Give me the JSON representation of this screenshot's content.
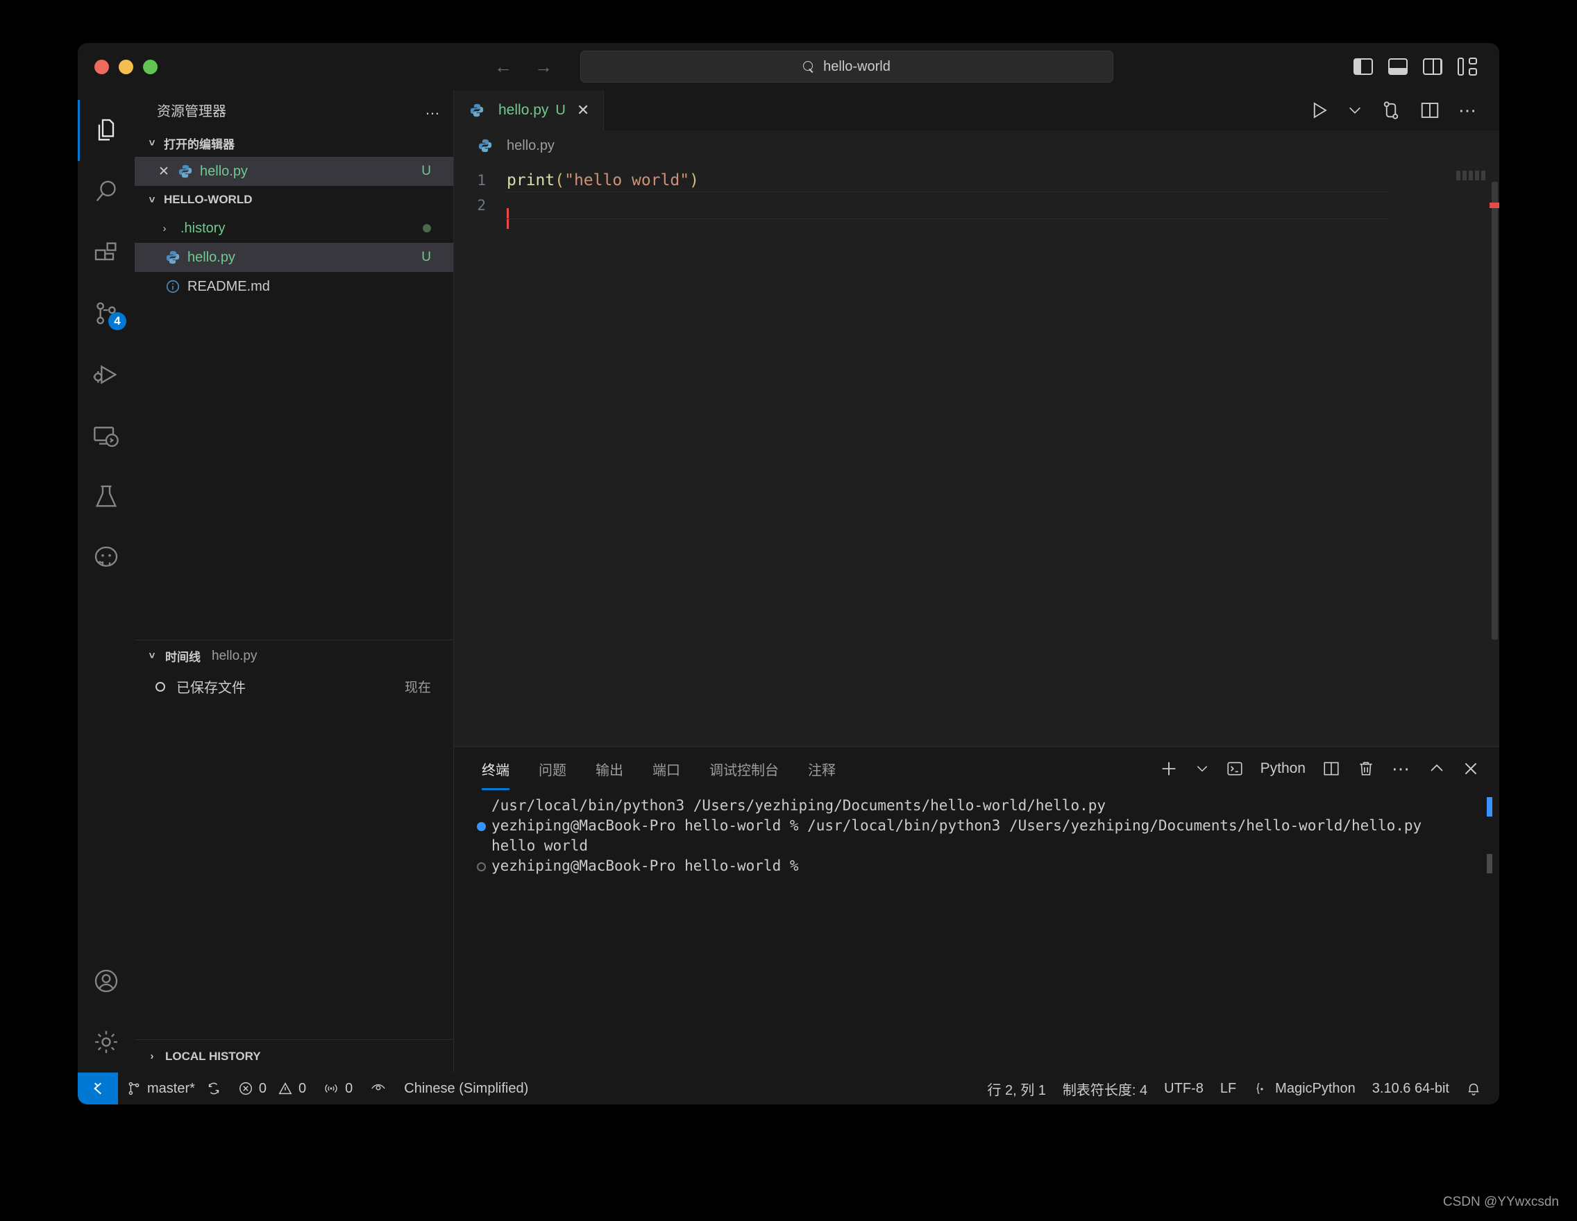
{
  "titlebar": {
    "search_value": "hello-world",
    "back_icon": "arrow-left-icon",
    "forward_icon": "arrow-right-icon",
    "layout_icons": [
      "toggle-primary-sidebar-icon",
      "toggle-panel-icon",
      "toggle-secondary-sidebar-icon",
      "customize-layout-icon"
    ]
  },
  "activitybar": {
    "items": [
      {
        "name": "explorer",
        "icon": "files-icon",
        "active": true,
        "badge": ""
      },
      {
        "name": "search",
        "icon": "search-icon",
        "active": false,
        "badge": ""
      },
      {
        "name": "extensions",
        "icon": "extensions-icon",
        "active": false,
        "badge": ""
      },
      {
        "name": "source-control",
        "icon": "source-control-icon",
        "active": false,
        "badge": "4"
      },
      {
        "name": "run-and-debug",
        "icon": "run-debug-icon",
        "active": false,
        "badge": ""
      },
      {
        "name": "remote-explorer",
        "icon": "remote-icon",
        "active": false,
        "badge": ""
      },
      {
        "name": "testing",
        "icon": "beaker-icon",
        "active": false,
        "badge": ""
      },
      {
        "name": "github",
        "icon": "github-icon",
        "active": false,
        "badge": ""
      }
    ],
    "bottom_items": [
      {
        "name": "accounts",
        "icon": "account-icon"
      },
      {
        "name": "settings",
        "icon": "gear-icon"
      }
    ]
  },
  "sidebar": {
    "title": "资源管理器",
    "more_label": "…",
    "open_editors": {
      "label": "打开的编辑器",
      "items": [
        {
          "name": "hello.py",
          "badge": "U",
          "close": "✕",
          "selected": true
        }
      ]
    },
    "workspace": {
      "label": "HELLO-WORLD",
      "items": [
        {
          "name": ".history",
          "kind": "folder",
          "badge": "",
          "dot": true,
          "selected": false
        },
        {
          "name": "hello.py",
          "kind": "python",
          "badge": "U",
          "dot": false,
          "selected": true
        },
        {
          "name": "README.md",
          "kind": "info",
          "badge": "",
          "dot": false,
          "selected": false
        }
      ]
    },
    "timeline": {
      "label": "时间线",
      "subject": "hello.py",
      "items": [
        {
          "label": "已保存文件",
          "when": "现在"
        }
      ]
    },
    "local_history": {
      "label": "LOCAL HISTORY"
    }
  },
  "editor": {
    "tabs": [
      {
        "label": "hello.py",
        "badge": "U",
        "close": "✕",
        "active": true
      }
    ],
    "toolbar_icons": [
      "run-python-file-icon",
      "run-chevron-icon",
      "source-control-compare-icon",
      "split-editor-icon",
      "more-actions-icon"
    ],
    "breadcrumb": "hello.py",
    "lines": [
      {
        "number": "1",
        "tokens": [
          {
            "text": "print",
            "type": "fn"
          },
          {
            "text": "(",
            "type": "paren"
          },
          {
            "text": "\"hello world\"",
            "type": "str"
          },
          {
            "text": ")",
            "type": "paren"
          }
        ]
      },
      {
        "number": "2",
        "tokens": []
      }
    ]
  },
  "panel": {
    "tabs": [
      {
        "label": "终端",
        "active": true
      },
      {
        "label": "问题",
        "active": false
      },
      {
        "label": "输出",
        "active": false
      },
      {
        "label": "端口",
        "active": false
      },
      {
        "label": "调试控制台",
        "active": false
      },
      {
        "label": "注释",
        "active": false
      }
    ],
    "terminal_name": "Python",
    "action_icons": [
      "new-terminal-icon",
      "terminal-profile-chevron-icon",
      "terminal-icon",
      "split-terminal-icon",
      "kill-terminal-icon",
      "more-actions-icon",
      "maximize-panel-icon",
      "close-panel-icon"
    ],
    "terminal_lines": [
      {
        "marker": "none",
        "text": "/usr/local/bin/python3 /Users/yezhiping/Documents/hello-world/hello.py"
      },
      {
        "marker": "filled",
        "text": "yezhiping@MacBook-Pro hello-world % /usr/local/bin/python3 /Users/yezhiping/Documents/hello-world/hello.py"
      },
      {
        "marker": "none",
        "text": "hello world"
      },
      {
        "marker": "empty",
        "text": "yezhiping@MacBook-Pro hello-world % "
      }
    ]
  },
  "statusbar": {
    "remote_icon": "remote-window-icon",
    "branch": "master*",
    "sync_icon": "sync-icon",
    "errors": "0",
    "warnings": "0",
    "ports": "0",
    "eye_icon": "eye-icon",
    "language_mode_left": "Chinese (Simplified)",
    "cursor_position": "行 2, 列 1",
    "tab_size": "制表符长度: 4",
    "encoding": "UTF-8",
    "eol": "LF",
    "theme_token": "MagicPython",
    "interpreter": "3.10.6 64-bit",
    "bell_icon": "bell-icon"
  },
  "watermark": "CSDN @YYwxcsdn",
  "colors": {
    "accent": "#0078d4",
    "green": "#73c991",
    "string": "#ce9178",
    "function": "#dcdcaa",
    "paren": "#d7ba7d",
    "caret": "#e84a4a"
  }
}
